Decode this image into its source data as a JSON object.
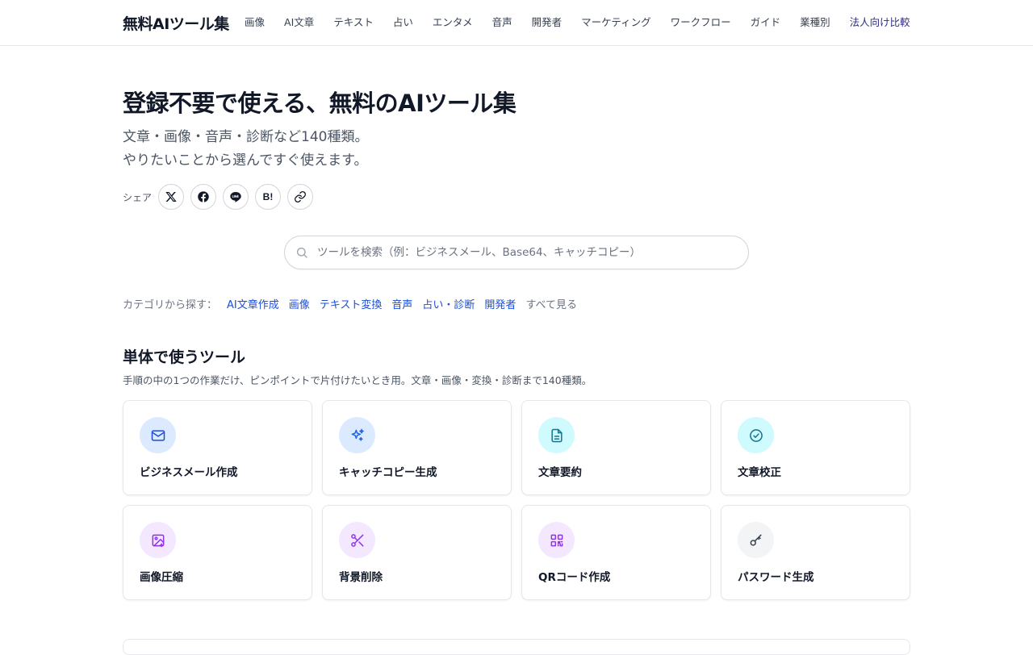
{
  "header": {
    "brand": "無料AIツール集",
    "nav": [
      {
        "label": "画像"
      },
      {
        "label": "AI文章"
      },
      {
        "label": "テキスト"
      },
      {
        "label": "占い"
      },
      {
        "label": "エンタメ"
      },
      {
        "label": "音声"
      },
      {
        "label": "開発者"
      },
      {
        "label": "マーケティング"
      },
      {
        "label": "ワークフロー"
      },
      {
        "label": "ガイド"
      },
      {
        "label": "業種別"
      },
      {
        "label": "法人向け比較"
      }
    ]
  },
  "hero": {
    "title": "登録不要で使える、無料のAIツール集",
    "subtitle_line1": "文章・画像・音声・診断など140種類。",
    "subtitle_line2": "やりたいことから選んですぐ使えます。"
  },
  "share": {
    "label": "シェア",
    "hatena_text": "B!"
  },
  "search": {
    "placeholder": "ツールを検索（例：ビジネスメール、Base64、キャッチコピー）",
    "value": ""
  },
  "categories": {
    "label": "カテゴリから探す：",
    "items": [
      {
        "label": "AI文章作成"
      },
      {
        "label": "画像"
      },
      {
        "label": "テキスト変換"
      },
      {
        "label": "音声"
      },
      {
        "label": "占い・診断"
      },
      {
        "label": "開発者"
      }
    ],
    "all_label": "すべて見る"
  },
  "section": {
    "title": "単体で使うツール",
    "description": "手順の中の1つの作業だけ、ピンポイントで片付けたいとき用。文章・画像・変換・診断まで140種類。"
  },
  "tools": [
    {
      "name": "ビジネスメール作成",
      "icon": "mail-icon",
      "icon_bg": "#dbeafe",
      "icon_color": "#1d4ed8"
    },
    {
      "name": "キャッチコピー生成",
      "icon": "sparkles-icon",
      "icon_bg": "#dbeafe",
      "icon_color": "#2563eb"
    },
    {
      "name": "文章要約",
      "icon": "document-icon",
      "icon_bg": "#cffafe",
      "icon_color": "#0e7490"
    },
    {
      "name": "文章校正",
      "icon": "check-circle-icon",
      "icon_bg": "#cffafe",
      "icon_color": "#0e7490"
    },
    {
      "name": "画像圧縮",
      "icon": "image-icon",
      "icon_bg": "#f3e8ff",
      "icon_color": "#9333ea"
    },
    {
      "name": "背景削除",
      "icon": "scissors-icon",
      "icon_bg": "#f3e8ff",
      "icon_color": "#9333ea"
    },
    {
      "name": "QRコード作成",
      "icon": "qr-code-icon",
      "icon_bg": "#f3e8ff",
      "icon_color": "#9333ea"
    },
    {
      "name": "パスワード生成",
      "icon": "key-icon",
      "icon_bg": "#f3f4f6",
      "icon_color": "#374151"
    }
  ]
}
